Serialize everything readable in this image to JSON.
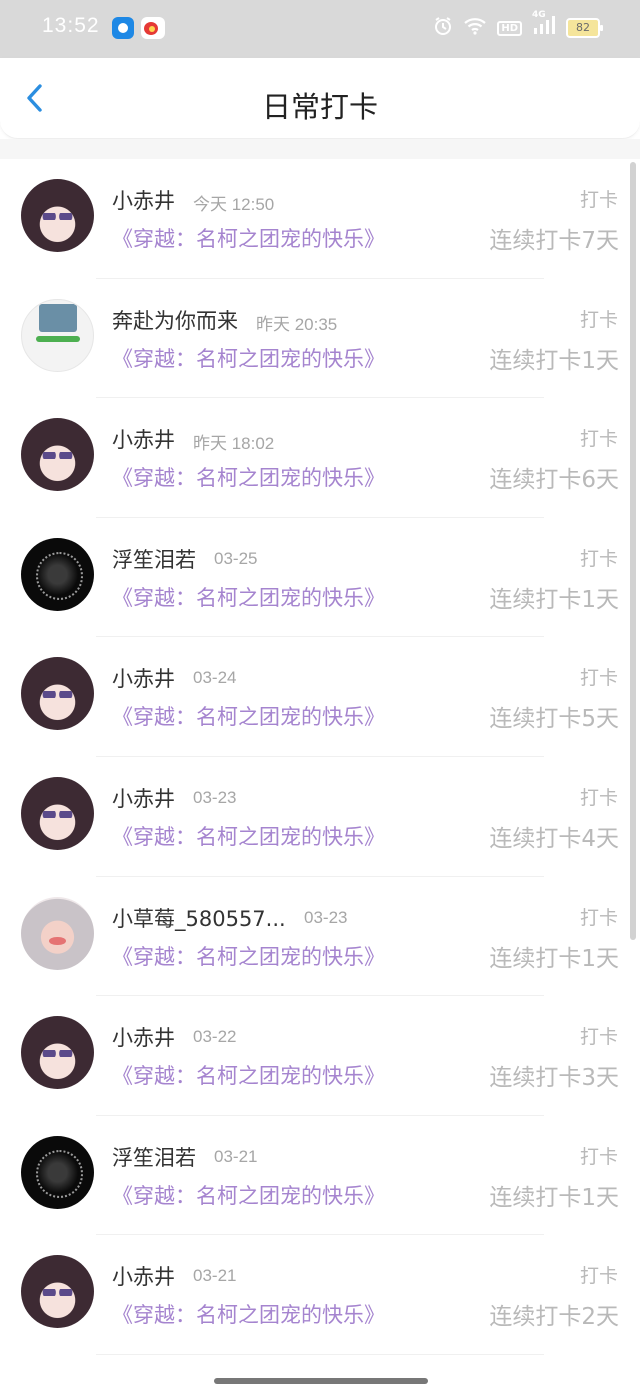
{
  "status_bar": {
    "time": "13:52",
    "network": "4G",
    "hd": "HD",
    "battery": "82",
    "icons": [
      "app-blue-icon",
      "weibo-icon",
      "alarm-icon",
      "wifi-icon",
      "signal-icon",
      "battery-icon"
    ]
  },
  "header": {
    "title": "日常打卡",
    "back_icon": "chevron-left-icon",
    "accent_color": "#2b8ee0"
  },
  "colors": {
    "book_title": "#a584cf",
    "muted": "#b9b9b9"
  },
  "checkins": [
    {
      "name": "小赤井",
      "time": "今天 12:50",
      "book": "《穿越：名柯之团宠的快乐》",
      "action": "打卡",
      "streak": "连续打卡7天",
      "avatar": "anime-girl-avatar"
    },
    {
      "name": "奔赴为你而来",
      "time": "昨天 20:35",
      "book": "《穿越：名柯之团宠的快乐》",
      "action": "打卡",
      "streak": "连续打卡1天",
      "avatar": "photo-avatar"
    },
    {
      "name": "小赤井",
      "time": "昨天 18:02",
      "book": "《穿越：名柯之团宠的快乐》",
      "action": "打卡",
      "streak": "连续打卡6天",
      "avatar": "anime-girl-avatar"
    },
    {
      "name": "浮笙泪若",
      "time": "03-25",
      "book": "《穿越：名柯之团宠的快乐》",
      "action": "打卡",
      "streak": "连续打卡1天",
      "avatar": "dark-floral-avatar"
    },
    {
      "name": "小赤井",
      "time": "03-24",
      "book": "《穿越：名柯之团宠的快乐》",
      "action": "打卡",
      "streak": "连续打卡5天",
      "avatar": "anime-girl-avatar"
    },
    {
      "name": "小赤井",
      "time": "03-23",
      "book": "《穿越：名柯之团宠的快乐》",
      "action": "打卡",
      "streak": "连续打卡4天",
      "avatar": "anime-girl-avatar"
    },
    {
      "name": "小草莓_580557...",
      "time": "03-23",
      "book": "《穿越：名柯之团宠的快乐》",
      "action": "打卡",
      "streak": "连续打卡1天",
      "avatar": "pink-girl-avatar"
    },
    {
      "name": "小赤井",
      "time": "03-22",
      "book": "《穿越：名柯之团宠的快乐》",
      "action": "打卡",
      "streak": "连续打卡3天",
      "avatar": "anime-girl-avatar"
    },
    {
      "name": "浮笙泪若",
      "time": "03-21",
      "book": "《穿越：名柯之团宠的快乐》",
      "action": "打卡",
      "streak": "连续打卡1天",
      "avatar": "dark-floral-avatar"
    },
    {
      "name": "小赤井",
      "time": "03-21",
      "book": "《穿越：名柯之团宠的快乐》",
      "action": "打卡",
      "streak": "连续打卡2天",
      "avatar": "anime-girl-avatar"
    }
  ]
}
